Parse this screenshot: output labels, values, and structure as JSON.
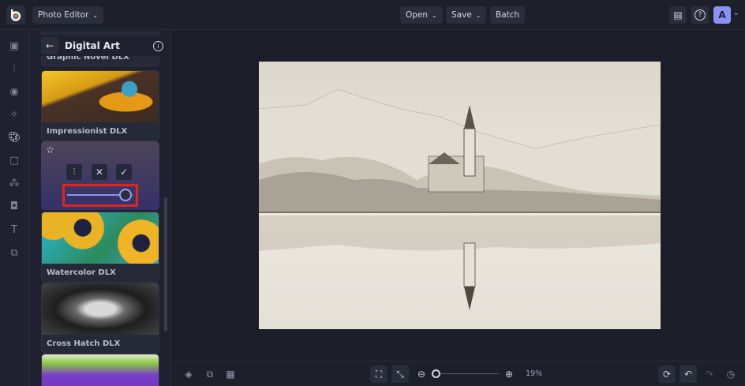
{
  "topbar": {
    "app_menu": "Photo Editor",
    "open": "Open",
    "save": "Save",
    "batch": "Batch",
    "avatar": "A"
  },
  "panel": {
    "title": "Digital Art",
    "cards": [
      {
        "label": "Graphic Novel DLX"
      },
      {
        "label": "Impressionist DLX"
      },
      {
        "label": "Watercolor DLX"
      },
      {
        "label": "Cross Hatch DLX"
      }
    ],
    "active_effect": {
      "slider_value_percent": 88
    }
  },
  "bottombar": {
    "zoom": "19%"
  },
  "colors": {
    "highlight": "#e0261b",
    "accent": "#8a93f5"
  }
}
